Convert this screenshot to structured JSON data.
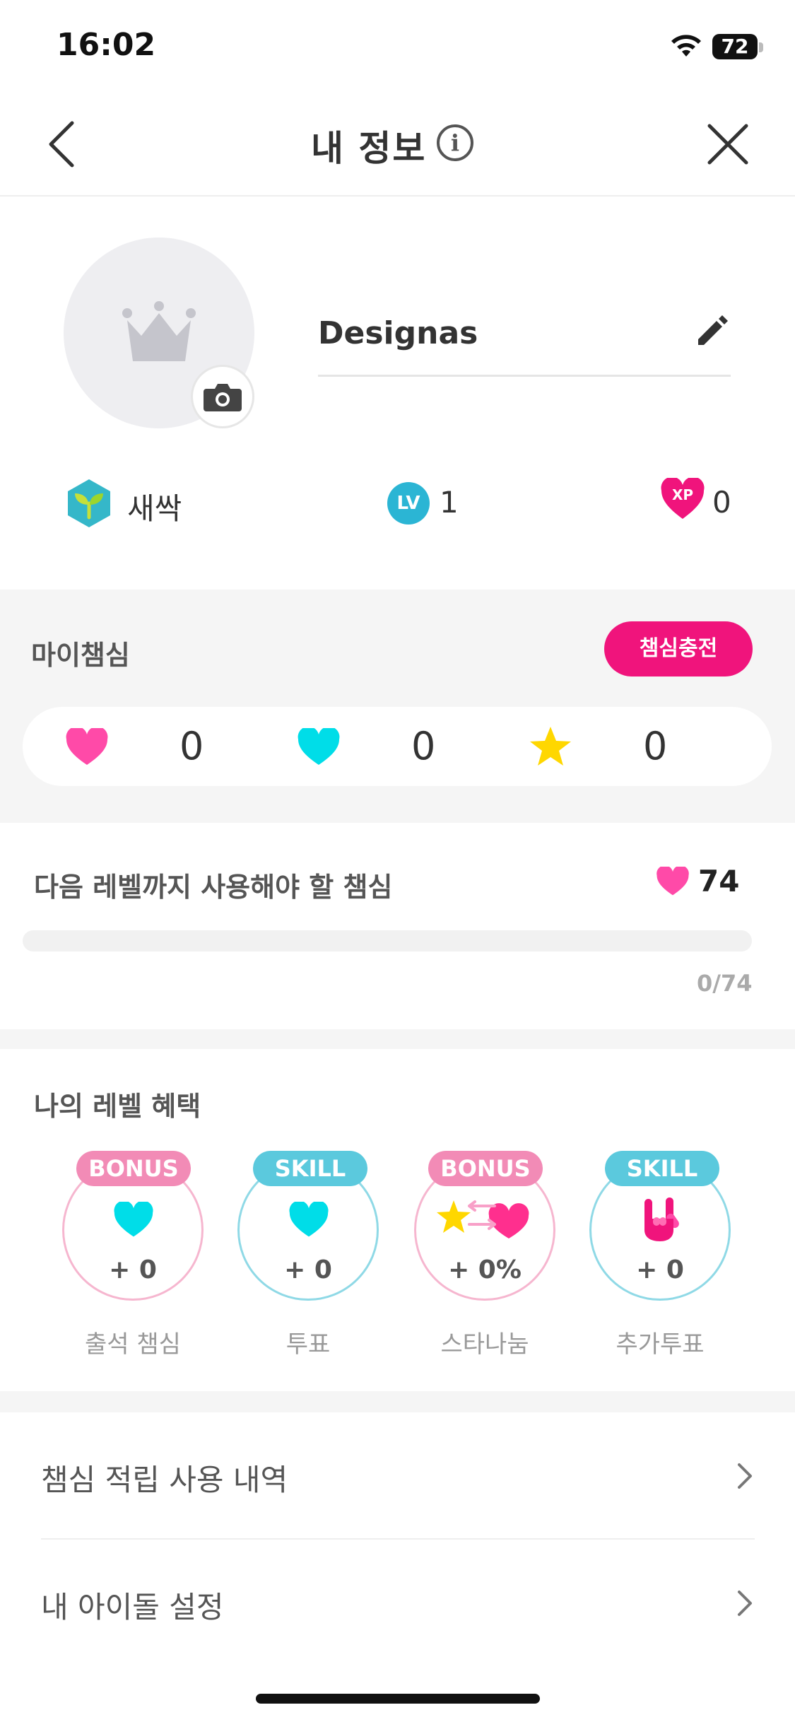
{
  "status_bar": {
    "time": "16:02",
    "battery": "72"
  },
  "nav": {
    "title": "내 정보",
    "info_glyph": "i"
  },
  "profile": {
    "nickname": "Designas",
    "grade_label": "새싹",
    "level_badge": "LV",
    "level": "1",
    "xp_badge": "XP",
    "xp": "0"
  },
  "my_champsim": {
    "title": "마이챔심",
    "charge_button": "챔심충전",
    "pink_heart": "0",
    "cyan_heart": "0",
    "star": "0"
  },
  "next_level": {
    "label": "다음 레벨까지 사용해야 할 챔심",
    "required": "74",
    "progress_text": "0/74",
    "progress_fraction": 0
  },
  "benefits": {
    "title": "나의 레벨 혜택",
    "items": [
      {
        "tag": "BONUS",
        "value": "+ 0",
        "label": "출석 챔심",
        "icon": "cyan-heart-icon"
      },
      {
        "tag": "SKILL",
        "value": "+ 0",
        "label": "투표",
        "icon": "cyan-heart-icon"
      },
      {
        "tag": "BONUS",
        "value": "+ 0%",
        "label": "스타나눔",
        "icon": "star-share-icon"
      },
      {
        "tag": "SKILL",
        "value": "+ 0",
        "label": "추가투표",
        "icon": "rock-hand-icon"
      }
    ]
  },
  "menu": [
    {
      "label": "챔심 적립 사용 내역"
    },
    {
      "label": "내 아이돌 설정"
    }
  ],
  "colors": {
    "accent": "#f0147c",
    "bonus_tag": "#f28bb6",
    "skill_tag": "#5bc9dd",
    "cyan_heart": "#00dde8",
    "pink_heart": "#ff4aa8",
    "star": "#ffd700"
  }
}
